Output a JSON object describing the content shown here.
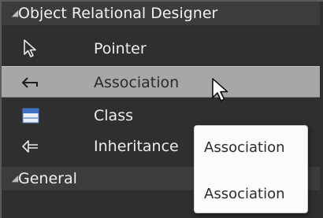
{
  "toolbox": {
    "groups": [
      {
        "title": "Object Relational Designer",
        "items": [
          {
            "label": "Pointer",
            "icon": "pointer-arrow-icon"
          },
          {
            "label": "Association",
            "icon": "association-arrow-icon",
            "selected": true
          },
          {
            "label": "Class",
            "icon": "class-icon"
          },
          {
            "label": "Inheritance",
            "icon": "inheritance-arrow-icon"
          }
        ]
      },
      {
        "title": "General",
        "items": []
      }
    ]
  },
  "tooltip": {
    "title": "Association",
    "description": "Association"
  },
  "colors": {
    "background": "#2f2f31",
    "group_header": "#3c3c3e",
    "selected_row": "#a7a7a7",
    "tooltip_background": "#fbfbfb"
  }
}
